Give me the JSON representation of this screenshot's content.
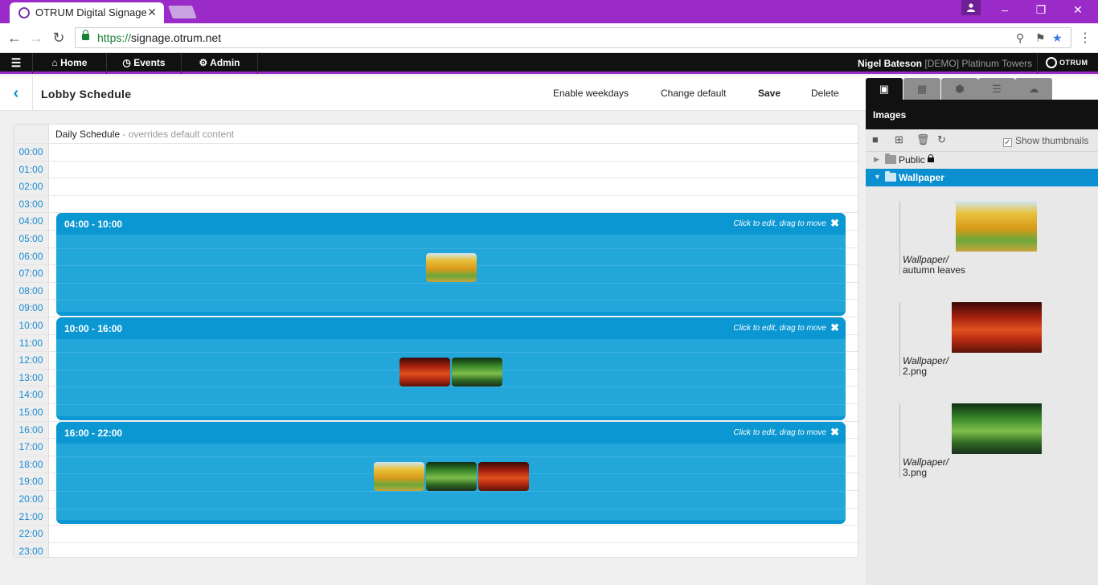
{
  "browser": {
    "tab_title": "OTRUM Digital Signage",
    "tab_close": "✕",
    "url_prefix": "https://",
    "url_host": "signage.otrum.net"
  },
  "nav": {
    "items": [
      {
        "icon": "home-icon",
        "label": "Home"
      },
      {
        "icon": "clock-icon",
        "label": "Events"
      },
      {
        "icon": "gears-icon",
        "label": "Admin"
      }
    ],
    "user_name": "Nigel Bateson",
    "user_extra": "[DEMO] Platinum Towers",
    "logo_text": "OTRUM"
  },
  "page": {
    "title": "Lobby Schedule",
    "actions": [
      "Enable weekdays",
      "Change default",
      "Save",
      "Delete"
    ]
  },
  "schedule": {
    "label": "Daily Schedule",
    "sublabel": " - overrides default content",
    "hours": [
      "00:00",
      "01:00",
      "02:00",
      "03:00",
      "04:00",
      "05:00",
      "06:00",
      "07:00",
      "08:00",
      "09:00",
      "10:00",
      "11:00",
      "12:00",
      "13:00",
      "14:00",
      "15:00",
      "16:00",
      "17:00",
      "18:00",
      "19:00",
      "20:00",
      "21:00",
      "22:00",
      "23:00"
    ],
    "blocks": [
      {
        "time": "04:00 - 10:00",
        "start": 4,
        "end": 10,
        "hint": "Click to edit, drag to move",
        "images": [
          "autumn"
        ]
      },
      {
        "time": "10:00 - 16:00",
        "start": 10,
        "end": 16,
        "hint": "Click to edit, drag to move",
        "images": [
          "red",
          "green"
        ]
      },
      {
        "time": "16:00 - 22:00",
        "start": 16,
        "end": 22,
        "hint": "Click to edit, drag to move",
        "images": [
          "autumn",
          "green",
          "red"
        ]
      }
    ]
  },
  "panel": {
    "tabs": [
      "image-icon",
      "film-icon",
      "box-icon",
      "list-icon",
      "cloud-download-icon"
    ],
    "heading": "Images",
    "show_thumbnails": "Show thumbnails",
    "folders": [
      {
        "label": "Public",
        "locked": true,
        "selected": false
      },
      {
        "label": "Wallpaper",
        "locked": false,
        "selected": true
      }
    ],
    "assets": [
      {
        "path": "Wallpaper/",
        "name": "autumn leaves",
        "kind": "autumn"
      },
      {
        "path": "Wallpaper/",
        "name": "2.png",
        "kind": "red"
      },
      {
        "path": "Wallpaper/",
        "name": "3.png",
        "kind": "green"
      }
    ]
  }
}
